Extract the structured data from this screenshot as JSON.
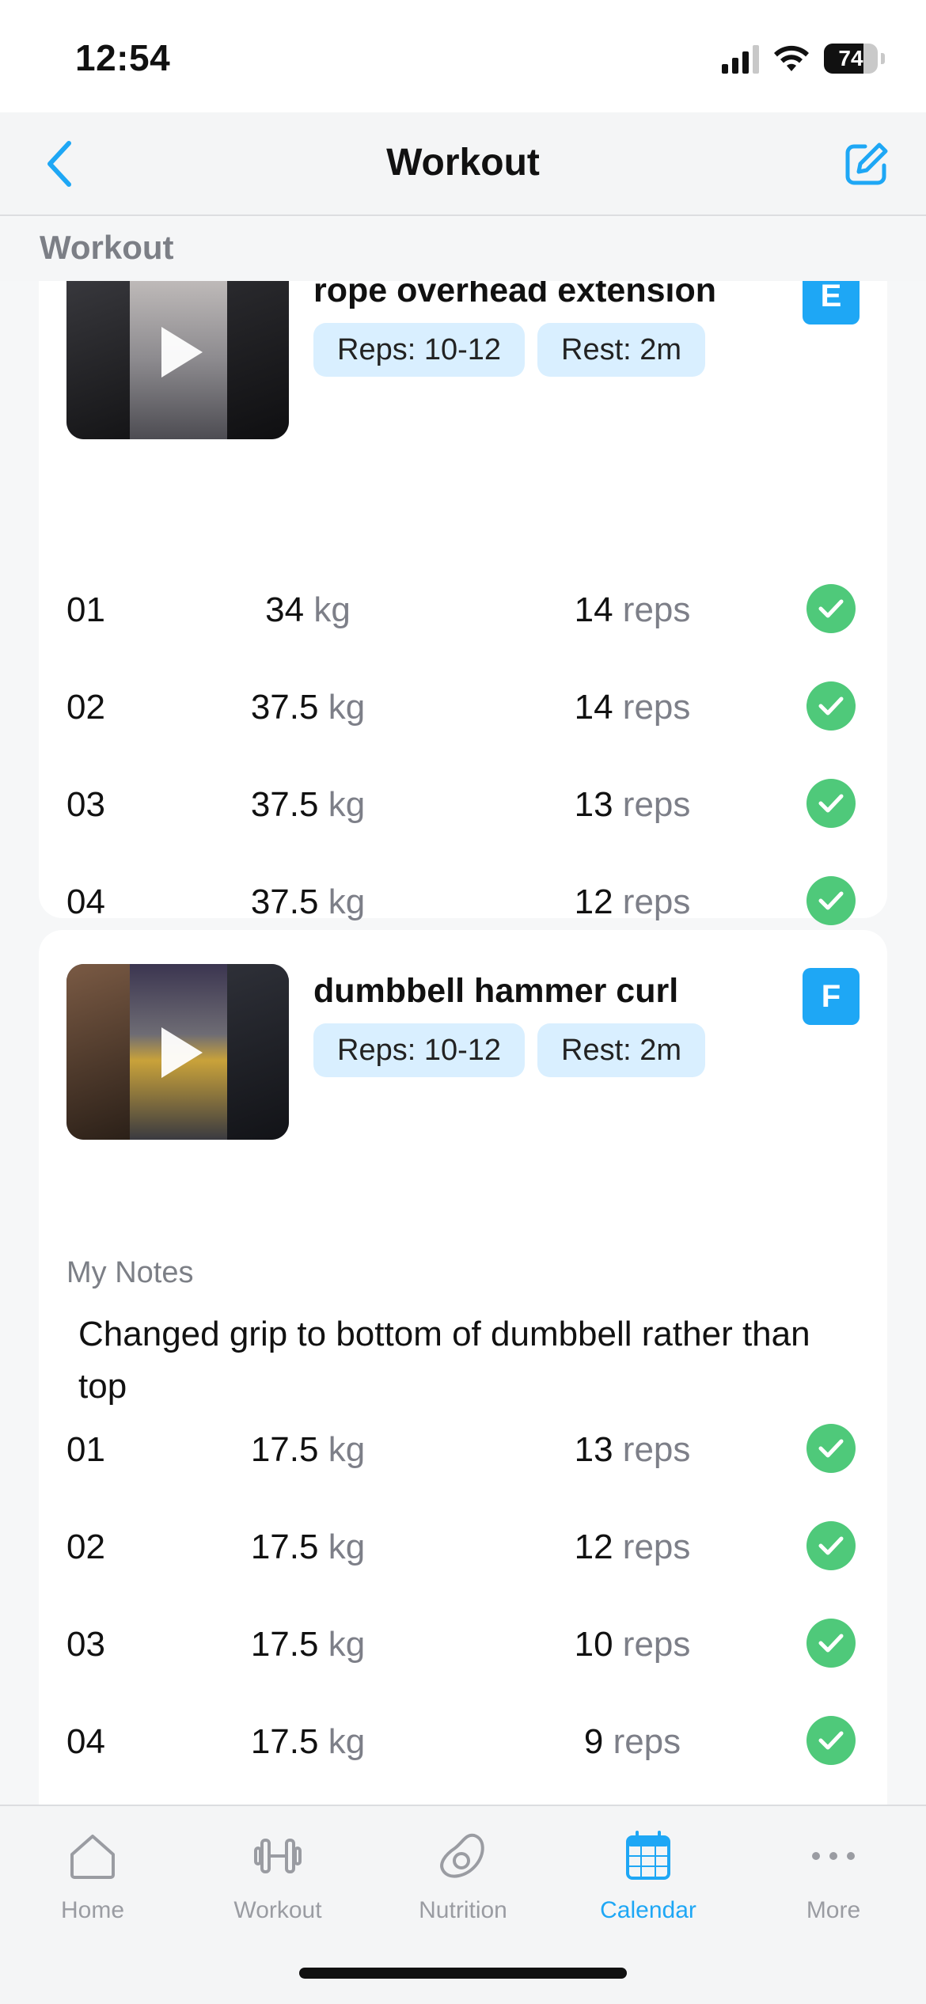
{
  "status_bar": {
    "time": "12:54",
    "battery": "74",
    "battery_level": 0.74
  },
  "nav": {
    "title": "Workout"
  },
  "section": {
    "title": "Workout"
  },
  "exercises": [
    {
      "title": "rope overhead extension",
      "letter": "E",
      "reps_chip": "Reps: 10-12",
      "rest_chip": "Rest: 2m",
      "sets": [
        {
          "num": "01",
          "weight": "34",
          "weight_unit": "kg",
          "reps": "14",
          "reps_unit": "reps"
        },
        {
          "num": "02",
          "weight": "37.5",
          "weight_unit": "kg",
          "reps": "14",
          "reps_unit": "reps"
        },
        {
          "num": "03",
          "weight": "37.5",
          "weight_unit": "kg",
          "reps": "13",
          "reps_unit": "reps"
        },
        {
          "num": "04",
          "weight": "37.5",
          "weight_unit": "kg",
          "reps": "12",
          "reps_unit": "reps"
        }
      ]
    },
    {
      "title": "dumbbell hammer curl",
      "letter": "F",
      "reps_chip": "Reps: 10-12",
      "rest_chip": "Rest: 2m",
      "notes_label": "My Notes",
      "notes": "Changed grip to bottom of dumbbell rather than top",
      "sets": [
        {
          "num": "01",
          "weight": "17.5",
          "weight_unit": "kg",
          "reps": "13",
          "reps_unit": "reps"
        },
        {
          "num": "02",
          "weight": "17.5",
          "weight_unit": "kg",
          "reps": "12",
          "reps_unit": "reps"
        },
        {
          "num": "03",
          "weight": "17.5",
          "weight_unit": "kg",
          "reps": "10",
          "reps_unit": "reps"
        },
        {
          "num": "04",
          "weight": "17.5",
          "weight_unit": "kg",
          "reps": "9",
          "reps_unit": "reps"
        }
      ]
    }
  ],
  "tabs": [
    {
      "label": "Home",
      "icon": "home-icon",
      "active": false
    },
    {
      "label": "Workout",
      "icon": "dumbbell-icon",
      "active": false
    },
    {
      "label": "Nutrition",
      "icon": "avocado-icon",
      "active": false
    },
    {
      "label": "Calendar",
      "icon": "calendar-icon",
      "active": true
    },
    {
      "label": "More",
      "icon": "more-icon",
      "active": false
    }
  ],
  "colors": {
    "accent": "#1ea7f5",
    "check": "#4fc97a",
    "chip": "#d9efff"
  }
}
